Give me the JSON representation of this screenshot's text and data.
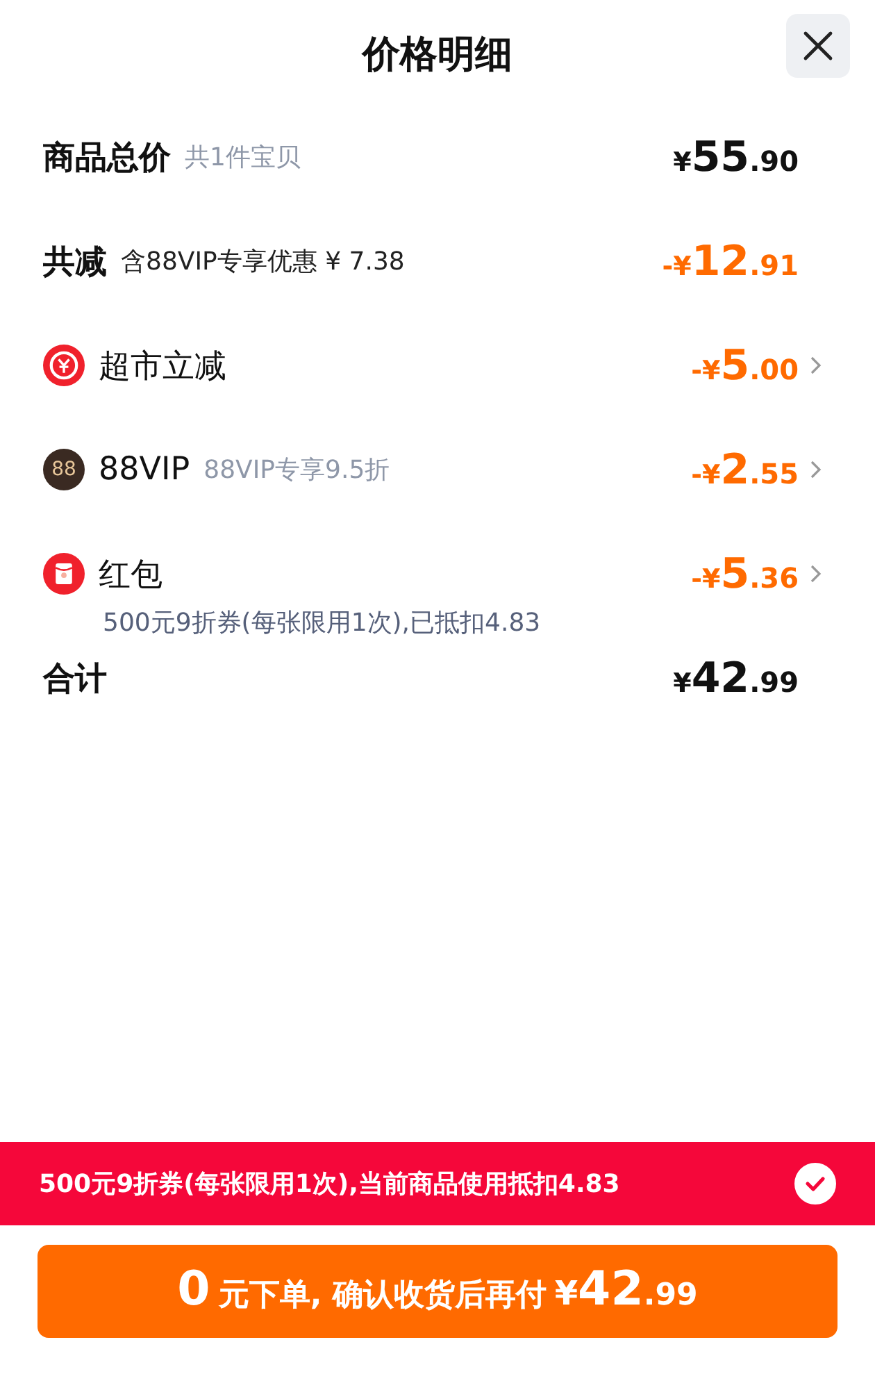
{
  "title": "价格明细",
  "rows": [
    {
      "kind": "total",
      "label": "商品总价",
      "note": "共1件宝贝",
      "sign": "",
      "currency": "¥",
      "whole": "55",
      "fraction": ".90"
    },
    {
      "kind": "saving",
      "label": "共减",
      "note": "含88VIP专享优惠 ¥ 7.38",
      "sign": "-",
      "currency": "¥",
      "whole": "12",
      "fraction": ".91"
    },
    {
      "kind": "market",
      "label": "超市立减",
      "sign": "-",
      "currency": "¥",
      "whole": "5",
      "fraction": ".00"
    },
    {
      "kind": "vip",
      "badge": "88",
      "label": "88VIP",
      "note": "88VIP专享9.5折",
      "sign": "-",
      "currency": "¥",
      "whole": "2",
      "fraction": ".55"
    },
    {
      "kind": "packet",
      "label": "红包",
      "sub": "500元9折券(每张限用1次),已抵扣4.83",
      "sign": "-",
      "currency": "¥",
      "whole": "5",
      "fraction": ".36"
    },
    {
      "kind": "total",
      "label": "合计",
      "sign": "",
      "currency": "¥",
      "whole": "42",
      "fraction": ".99"
    }
  ],
  "banner": {
    "text": "500元9折券(每张限用1次),当前商品使用抵扣4.83",
    "checked": true
  },
  "pay_button": {
    "lead": "0",
    "text": "元下单, 确认收货后再付",
    "currency": "¥",
    "whole": "42",
    "fraction": ".99"
  }
}
